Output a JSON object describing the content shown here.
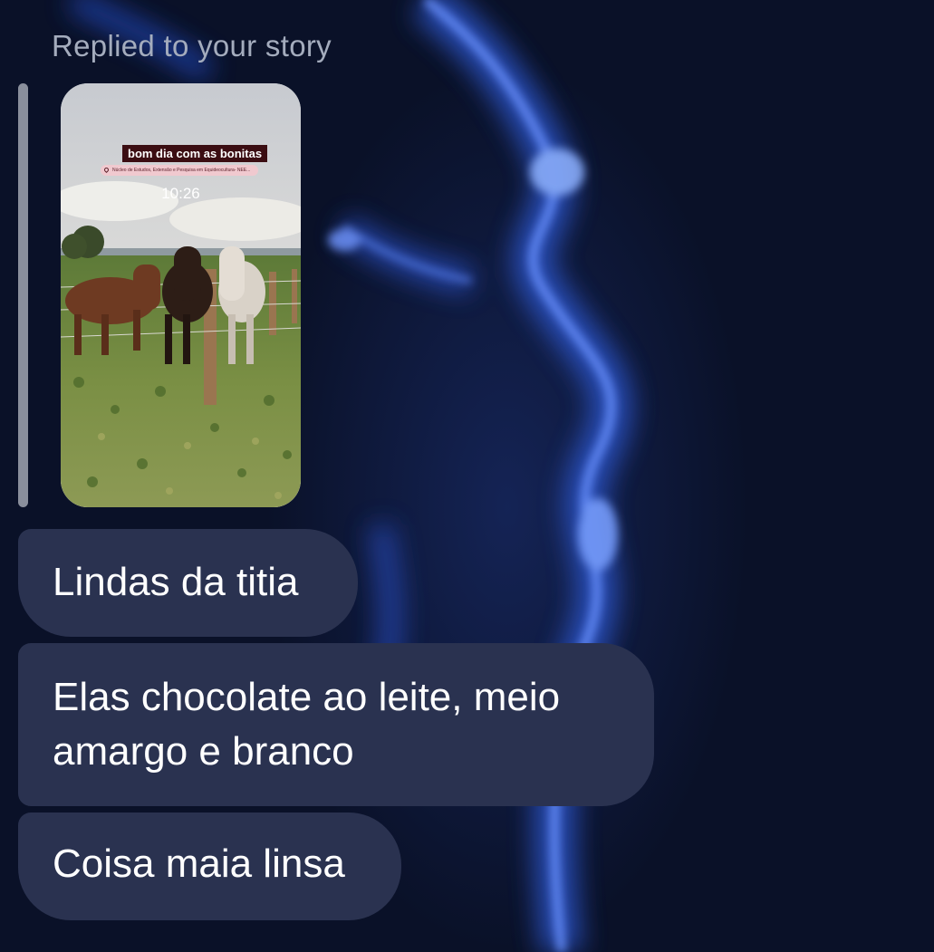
{
  "reply_header": {
    "label": "Replied to your story"
  },
  "story": {
    "title": "bom dia com as bonitas",
    "location": "Núcleo de Estudos, Extensão e Pesquisa em Equideocultura- NEE...",
    "time": "10:26",
    "image_description": "three horses behind a wooden fence in a grassy field"
  },
  "messages": [
    {
      "text": "Lindas da titia"
    },
    {
      "line1": "Elas chocolate ao leite, meio",
      "line2": "amargo e branco"
    },
    {
      "text": "Coisa maia linsa"
    }
  ],
  "colors": {
    "background": "#0a1128",
    "bubble": "#2a3250",
    "label": "#a4acbd",
    "reply_bar": "#8a8f9c"
  }
}
